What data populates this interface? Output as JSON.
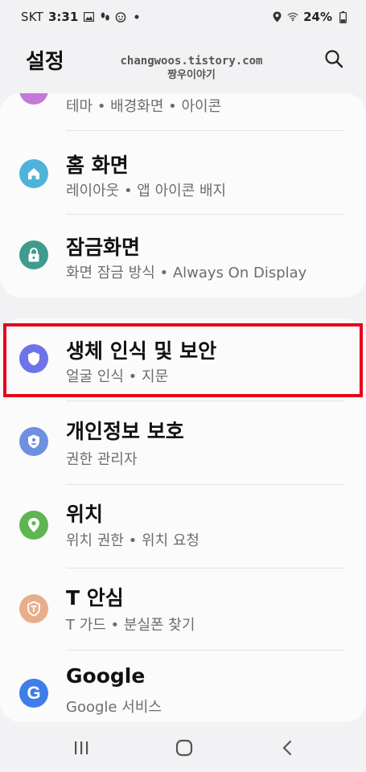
{
  "status_bar": {
    "carrier": "SKT",
    "time": "3:31",
    "battery": "24%"
  },
  "header": {
    "title": "설정",
    "watermark_line1": "changwoos.tistory.com",
    "watermark_line2": "짱우이야기"
  },
  "top_card": {
    "partial_item_subtitle": "테마 • 배경화면 • 아이콘",
    "items": [
      {
        "title": "홈 화면",
        "subtitle": "레이아웃 • 앱 아이콘 배지",
        "icon": "home-icon",
        "color": "#4fb3d9"
      },
      {
        "title": "잠금화면",
        "subtitle": "화면 잠금 방식 • Always On Display",
        "icon": "lock-icon",
        "color": "#3e9b8e"
      }
    ]
  },
  "bottom_card": {
    "items": [
      {
        "title": "생체 인식 및 보안",
        "subtitle": "얼굴 인식 • 지문",
        "icon": "shield-icon",
        "color": "#6d73e8"
      },
      {
        "title": "개인정보 보호",
        "subtitle": "권한 관리자",
        "icon": "privacy-icon",
        "color": "#6f8fe0"
      },
      {
        "title": "위치",
        "subtitle": "위치 권한 • 위치 요청",
        "icon": "location-pin-icon",
        "color": "#5db650"
      },
      {
        "title": "T 안심",
        "subtitle": "T 가드 • 분실폰 찾기",
        "icon": "t-guard-icon",
        "color": "#e7ae8b"
      },
      {
        "title": "Google",
        "subtitle": "Google 서비스",
        "icon": "google-icon",
        "color": "#3f7de8"
      }
    ]
  },
  "highlight_color": "#e8001a"
}
